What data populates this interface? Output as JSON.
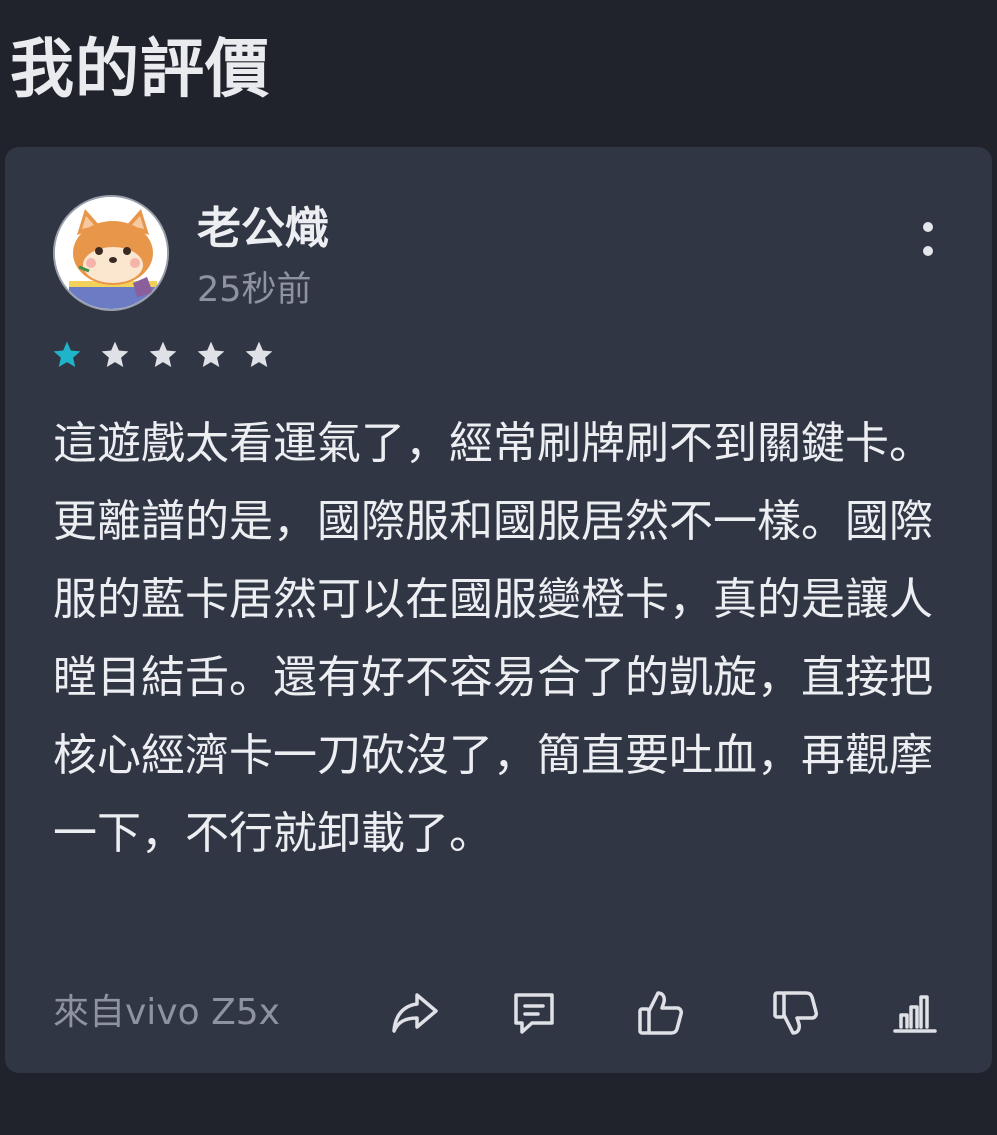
{
  "header": {
    "title": "我的評價"
  },
  "review": {
    "username": "老公熾",
    "time": "25秒前",
    "rating": 1,
    "max_rating": 5,
    "text": "這遊戲太看運氣了，經常刷牌刷不到關鍵卡。更離譜的是，國際服和國服居然不一樣。國際服的藍卡居然可以在國服變橙卡，真的是讓人瞠目結舌。還有好不容易合了的凱旋，直接把核心經濟卡一刀砍沒了，簡直要吐血，再觀摩一下，不行就卸載了。",
    "device": "來自vivo Z5x"
  },
  "icons": {
    "avatar": "shiba-dog-avatar",
    "more": "more-vertical-icon",
    "share": "share-icon",
    "comment": "comment-icon",
    "like": "thumbs-up-icon",
    "dislike": "thumbs-down-icon",
    "stats": "bar-chart-icon"
  },
  "colors": {
    "background": "#20232c",
    "card": "#313644",
    "star_active": "#1fb4c9",
    "star_inactive": "#dfe1e6",
    "muted_text": "#8e93a0"
  }
}
